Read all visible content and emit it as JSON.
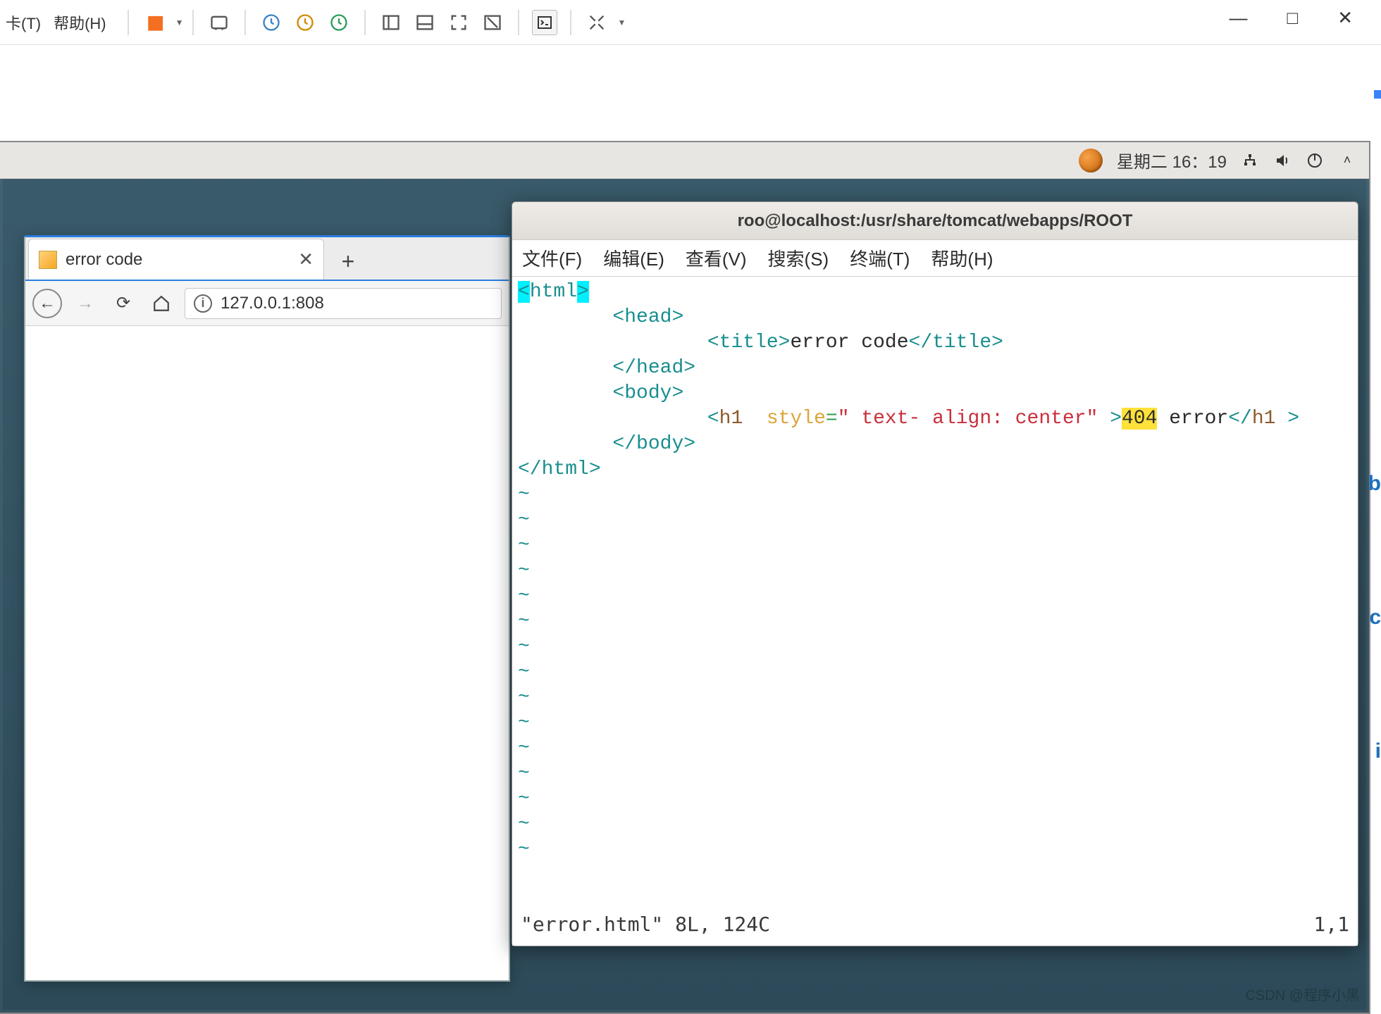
{
  "host": {
    "menu_card": "卡(T)",
    "menu_help": "帮助(H)",
    "win_min": "—",
    "win_max": "□",
    "win_close": "✕"
  },
  "gnome": {
    "day_time": "星期二 16：19"
  },
  "firefox": {
    "tab_title": "error code",
    "tab_close": "✕",
    "newtab": "+",
    "url": "127.0.0.1:808"
  },
  "terminal": {
    "title": "roo@localhost:/usr/share/tomcat/webapps/ROOT",
    "menus": [
      "文件(F)",
      "编辑(E)",
      "查看(V)",
      "搜索(S)",
      "终端(T)",
      "帮助(H)"
    ],
    "code": {
      "l1_open": "<",
      "l1_tag": "html",
      "l1_close": ">",
      "l2_open": "<",
      "l2_tag": "head",
      "l2_close": ">",
      "l3_open": "<",
      "l3_tag": "title",
      "l3_mid": ">",
      "l3_text": "error code",
      "l3_c1": "</",
      "l3_c2": "title",
      "l3_c3": ">",
      "l4_open": "</",
      "l4_tag": "head",
      "l4_close": ">",
      "l5_open": "<",
      "l5_tag": "body",
      "l5_close": ">",
      "l6_open": "<",
      "l6_tag": "h1",
      "l6_sp": "  ",
      "l6_attr": "style",
      "l6_eq": "=",
      "l6_q1": "\"",
      "l6_str": " text- align: center",
      "l6_q2": "\" ",
      "l6_gt": ">",
      "l6_hl": "404",
      "l6_rest": " error",
      "l6_c1": "</",
      "l6_c2": "h1",
      "l6_c3": " >",
      "l7_open": "</",
      "l7_tag": "body",
      "l7_close": ">",
      "l8_open": "</",
      "l8_tag": "html",
      "l8_close": ">"
    },
    "status_left": "\"error.html\" 8L, 124C",
    "status_right": "1,1"
  },
  "watermark": "CSDN @程序小黑"
}
